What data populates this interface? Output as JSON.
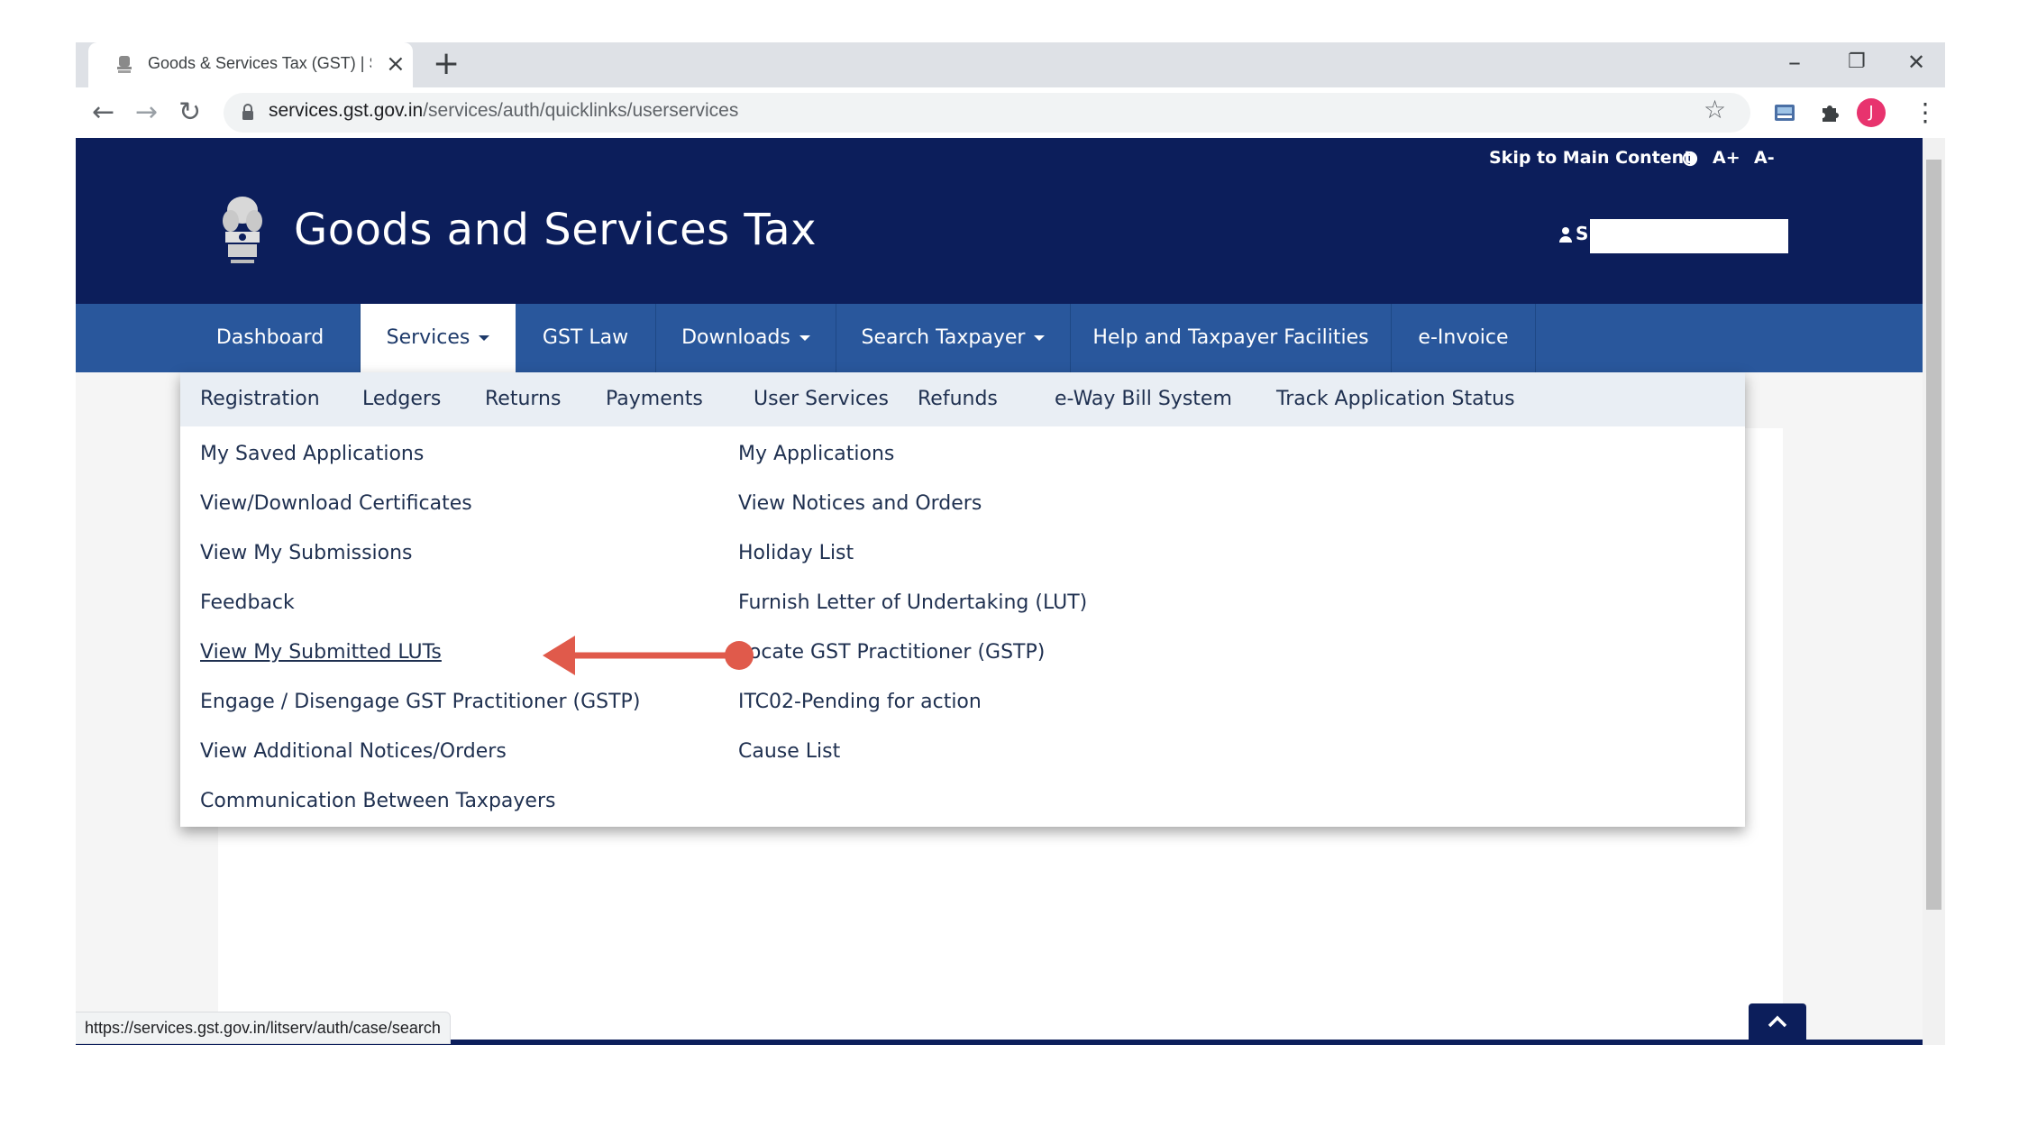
{
  "browser": {
    "tab_title": "Goods & Services Tax (GST) | Services",
    "tab_close": "×",
    "new_tab": "+",
    "window_controls": {
      "minimize": "–",
      "restore": "❐",
      "close": "✕"
    },
    "nav": {
      "back": "←",
      "forward": "→",
      "reload": "↻"
    },
    "url_host": "services.gst.gov.in",
    "url_path": "/services/auth/quicklinks/userservices",
    "bookmark": "☆",
    "profile_initial": "J",
    "menu": "⋮",
    "status_url": "https://services.gst.gov.in/litserv/auth/case/search",
    "colors": {
      "profile": "#e8336e",
      "chrome_bg": "#dee1e6"
    }
  },
  "site": {
    "skip_link": "Skip to Main Content",
    "font_increase": "A+",
    "font_decrease": "A-",
    "title": "Goods and Services Tax",
    "user_name": "S",
    "colors": {
      "header": "#0c1e5b",
      "nav": "#29579c",
      "annotation": "#e05a4b"
    }
  },
  "main_nav": [
    {
      "label": "Dashboard",
      "caret": false,
      "active": false
    },
    {
      "label": "Services",
      "caret": true,
      "active": true
    },
    {
      "label": "GST Law",
      "caret": false,
      "active": false
    },
    {
      "label": "Downloads",
      "caret": true,
      "active": false
    },
    {
      "label": "Search Taxpayer",
      "caret": true,
      "active": false
    },
    {
      "label": "Help and Taxpayer Facilities",
      "caret": false,
      "active": false
    },
    {
      "label": "e-Invoice",
      "caret": false,
      "active": false
    }
  ],
  "sub_nav": [
    "Registration",
    "Ledgers",
    "Returns",
    "Payments",
    "User Services",
    "Refunds",
    "e-Way Bill System",
    "Track Application Status"
  ],
  "menu_left": [
    "My Saved Applications",
    "View/Download Certificates",
    "View My Submissions",
    "Feedback",
    "View My Submitted LUTs",
    "Engage / Disengage GST Practitioner (GSTP)",
    "View Additional Notices/Orders",
    "Communication Between Taxpayers"
  ],
  "menu_right": [
    "My Applications",
    "View Notices and Orders",
    "Holiday List",
    "Furnish Letter of Undertaking (LUT)",
    "Locate GST Practitioner (GSTP)",
    "ITC02-Pending for action",
    "Cause List"
  ]
}
